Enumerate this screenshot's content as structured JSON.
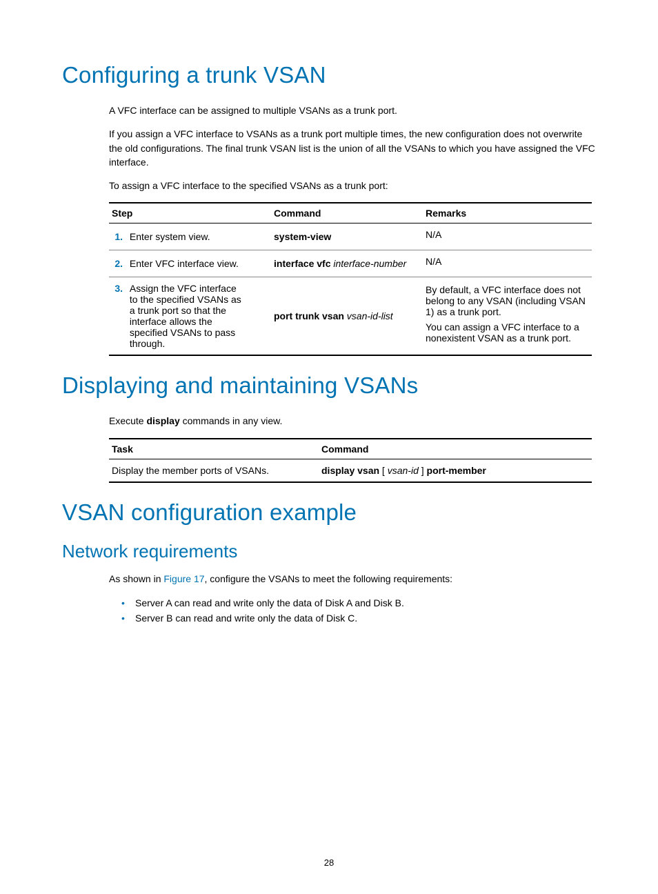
{
  "page_number": "28",
  "section1": {
    "heading": "Configuring a trunk VSAN",
    "p1": "A VFC interface can be assigned to multiple VSANs as a trunk port.",
    "p2": "If you assign a VFC interface to VSANs as a trunk port multiple times, the new configuration does not overwrite the old configurations. The final trunk VSAN list is the union of all the VSANs to which you have assigned the VFC interface.",
    "p3": "To assign a VFC interface to the specified VSANs as a trunk port:",
    "table": {
      "headers": {
        "step": "Step",
        "command": "Command",
        "remarks": "Remarks"
      },
      "rows": [
        {
          "num": "1.",
          "desc": "Enter system view.",
          "cmd_bold": "system-view",
          "cmd_italic": "",
          "remarks_p1": "N/A",
          "remarks_p2": ""
        },
        {
          "num": "2.",
          "desc": "Enter VFC interface view.",
          "cmd_bold": "interface vfc",
          "cmd_italic": "interface-number",
          "remarks_p1": "N/A",
          "remarks_p2": ""
        },
        {
          "num": "3.",
          "desc": "Assign the VFC interface to the specified VSANs as a trunk port so that the interface allows the specified VSANs to pass through.",
          "cmd_bold": "port trunk vsan",
          "cmd_italic": "vsan-id-list",
          "remarks_p1": "By default, a VFC interface does not belong to any VSAN (including VSAN 1) as a trunk port.",
          "remarks_p2": "You can assign a VFC interface to a nonexistent VSAN as a trunk port."
        }
      ]
    }
  },
  "section2": {
    "heading": "Displaying and maintaining VSANs",
    "p1_pre": "Execute ",
    "p1_bold": "display",
    "p1_post": " commands in any view.",
    "table": {
      "headers": {
        "task": "Task",
        "command": "Command"
      },
      "row": {
        "task": "Display the member ports of VSANs.",
        "cmd_b1": "display vsan",
        "cmd_i1": "vsan-id",
        "cmd_b2": "port-member",
        "bracket_open": " [ ",
        "bracket_close": " ] "
      }
    }
  },
  "section3": {
    "heading": "VSAN configuration example",
    "subheading": "Network requirements",
    "p1_pre": "As shown in ",
    "p1_link": "Figure 17",
    "p1_post": ", configure the VSANs to meet the following requirements:",
    "bullets": [
      "Server A can read and write only the data of Disk A and Disk B.",
      "Server B can read and write only the data of Disk C."
    ]
  }
}
